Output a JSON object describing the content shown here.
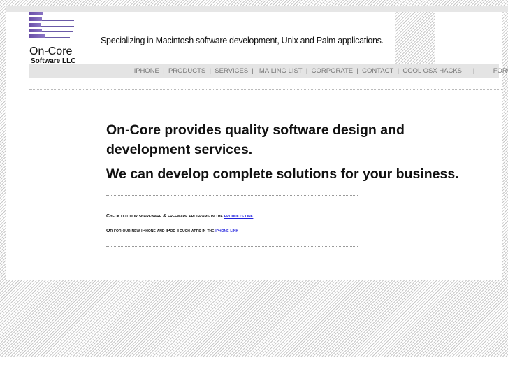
{
  "logo": {
    "name": "On-Core",
    "sub": "Software LLC",
    "color": "#6a4fa8"
  },
  "tagline": "Specializing in Macintosh software development, Unix and Palm applications.",
  "nav": [
    "iPHONE",
    "PRODUCTS",
    "SERVICES",
    "MAILING LIST",
    "CORPORATE",
    "CONTACT",
    "COOL OSX HACKS",
    "FORUMS"
  ],
  "content": {
    "headline1": "On-Core provides quality software design and development services.",
    "headline2": "We can develop complete solutions for your business.",
    "line1_text": "Check out our shareware & freeware programs in the ",
    "line1_link": "products link",
    "line2_text": "Or for our new iPhone and iPod Touch apps in the ",
    "line2_link": "iphone link",
    "link_color": "#2222dd"
  }
}
